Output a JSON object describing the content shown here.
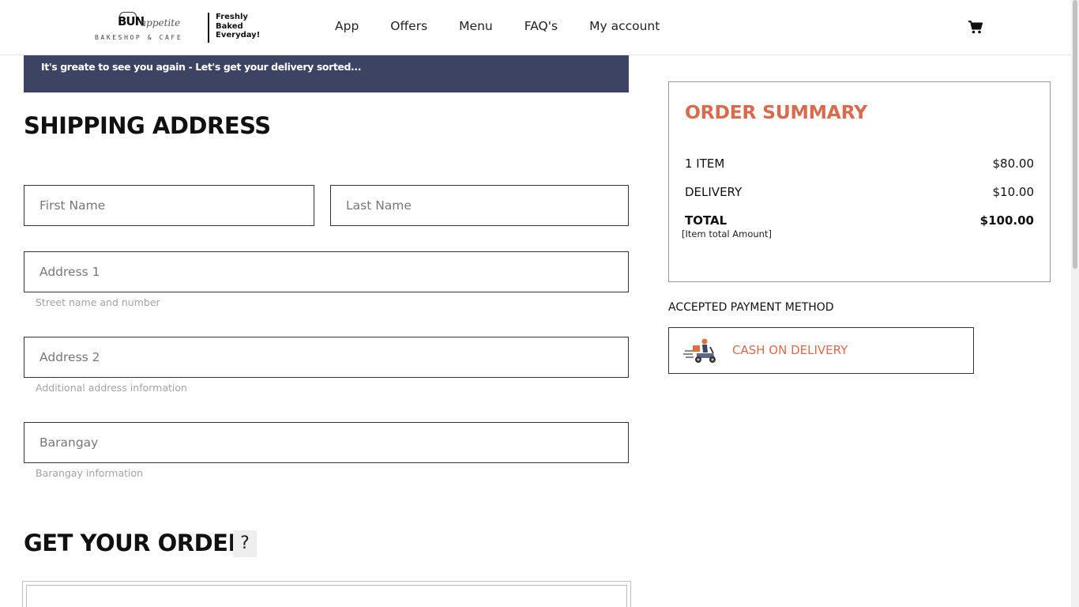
{
  "brand": {
    "name_main": "BUN",
    "name_script": "appetite",
    "subtitle": "BAKESHOP & CAFE",
    "tagline_lines": [
      "Freshly",
      "Baked",
      "Everyday!"
    ]
  },
  "nav": {
    "items": [
      {
        "label": "App"
      },
      {
        "label": "Offers"
      },
      {
        "label": "Menu"
      },
      {
        "label": "FAQ's"
      },
      {
        "label": "My account"
      }
    ],
    "cart_icon": "shopping-cart-icon"
  },
  "banner": {
    "text": "It's greate to see you again - Let's get your delivery sorted..."
  },
  "shipping": {
    "title": "SHIPPING ADDRESS",
    "first_name": {
      "placeholder": "First Name",
      "value": ""
    },
    "last_name": {
      "placeholder": "Last Name",
      "value": ""
    },
    "address1": {
      "placeholder": "Address 1",
      "value": "",
      "hint": "Street name and number"
    },
    "address2": {
      "placeholder": "Address 2",
      "value": "",
      "hint": "Additional address information"
    },
    "barangay": {
      "placeholder": "Barangay",
      "value": "",
      "hint": "Barangay information"
    }
  },
  "get_order": {
    "title": "GET YOUR ORDER",
    "help_label": "?"
  },
  "summary": {
    "title": "ORDER SUMMARY",
    "items_label": "1 ITEM",
    "items_value": "$80.00",
    "delivery_label": "DELIVERY",
    "delivery_value": "$10.00",
    "total_label": "TOTAL",
    "total_value": "$100.00",
    "total_note": "[Item total Amount]"
  },
  "payment": {
    "heading": "ACCEPTED PAYMENT METHOD",
    "method_label": "CASH ON DELIVERY",
    "method_icon": "delivery-scooter-icon"
  },
  "colors": {
    "accent": "#d86b4e",
    "banner_bg": "#3d4463",
    "text": "#111111"
  }
}
